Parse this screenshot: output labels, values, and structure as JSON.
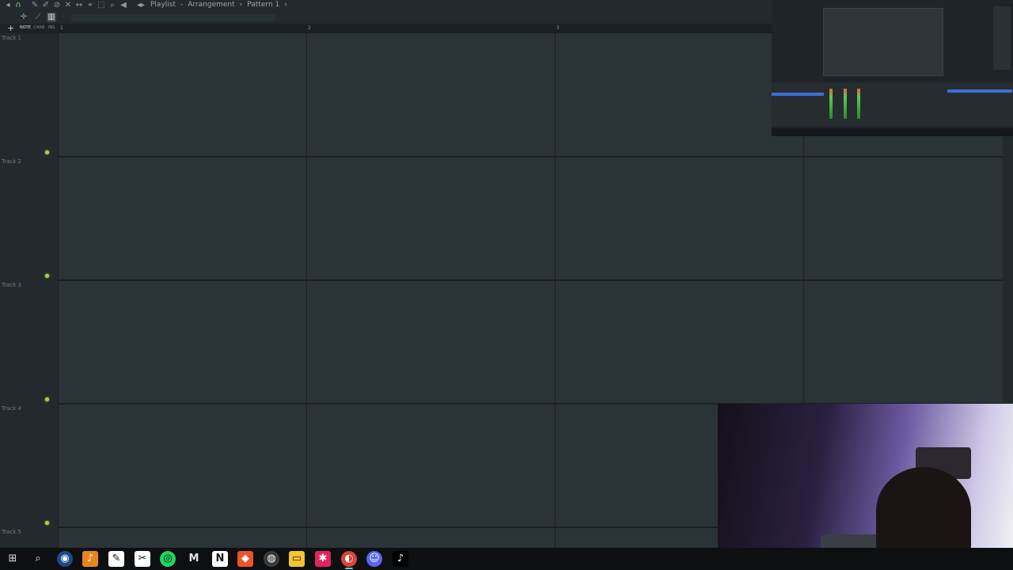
{
  "window": {
    "title_parts": [
      "Playlist",
      "Arrangement",
      "Pattern 1"
    ],
    "title_separator_1": "-",
    "title_separator_2": "›"
  },
  "toolbar": {
    "icons": [
      "magnet-icon",
      "pencil-icon",
      "brush-icon",
      "delete-icon",
      "mute-icon",
      "slip-icon",
      "slice-icon",
      "select-icon",
      "zoom-icon",
      "playback-icon",
      "arrow-left-icon"
    ]
  },
  "tabs": {
    "add": "+",
    "items": [
      "NOTE",
      "CHAN",
      "INS"
    ]
  },
  "ruler": {
    "bars": [
      "1",
      "2",
      "3"
    ]
  },
  "tracks": [
    {
      "name": "Track 1"
    },
    {
      "name": "Track 2"
    },
    {
      "name": "Track 3"
    },
    {
      "name": "Track 4"
    },
    {
      "name": "Track 5"
    }
  ],
  "colors": {
    "led": "#9fd34b",
    "grid": "#2a3336",
    "accent": "#3a6fd8"
  },
  "taskbar": {
    "apps": [
      {
        "name": "windows-start-icon",
        "glyph": "⊞",
        "color": "#dfe4e7",
        "bg": "transparent"
      },
      {
        "name": "search-icon",
        "glyph": "⌕",
        "color": "#dfe4e7",
        "bg": "transparent"
      },
      {
        "name": "steam-icon",
        "glyph": "◉",
        "color": "#ffffff",
        "bg": "#1b4a8a"
      },
      {
        "name": "fl-studio-icon",
        "glyph": "♪",
        "color": "#ffffff",
        "bg": "#e7871b"
      },
      {
        "name": "notion-like-icon",
        "glyph": "✎",
        "color": "#111111",
        "bg": "#ffffff"
      },
      {
        "name": "capcut-icon",
        "glyph": "✂",
        "color": "#111111",
        "bg": "#ffffff"
      },
      {
        "name": "spotify-icon",
        "glyph": "◎",
        "color": "#111111",
        "bg": "#1ed760"
      },
      {
        "name": "medium-icon",
        "glyph": "M",
        "color": "#ffffff",
        "bg": "transparent"
      },
      {
        "name": "notion-icon",
        "glyph": "N",
        "color": "#111111",
        "bg": "#ffffff"
      },
      {
        "name": "brave-icon",
        "glyph": "◆",
        "color": "#ffffff",
        "bg": "#f05228"
      },
      {
        "name": "obs-icon",
        "glyph": "◍",
        "color": "#ffffff",
        "bg": "#3a3a3a"
      },
      {
        "name": "file-explorer-icon",
        "glyph": "▭",
        "color": "#2a2a2a",
        "bg": "#f4c430"
      },
      {
        "name": "melodyne-icon",
        "glyph": "✱",
        "color": "#ffffff",
        "bg": "#e0245e"
      },
      {
        "name": "chrome-icon",
        "glyph": "◐",
        "color": "#ffffff",
        "bg": "#db4437",
        "active": true
      },
      {
        "name": "discord-icon",
        "glyph": "☺",
        "color": "#ffffff",
        "bg": "#5865f2"
      },
      {
        "name": "tiktok-icon",
        "glyph": "♪",
        "color": "#ffffff",
        "bg": "#000000"
      }
    ]
  }
}
